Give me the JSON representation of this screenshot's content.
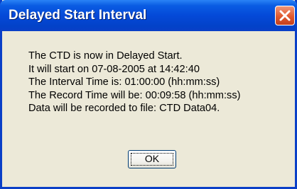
{
  "dialog": {
    "title": "Delayed Start Interval",
    "lines": [
      "The CTD is now in Delayed Start.",
      "It will start on 07-08-2005 at 14:42:40",
      "The Interval Time is: 01:00:00 (hh:mm:ss)",
      "The Record Time will be: 00:09:58 (hh:mm:ss)",
      "Data will be recorded to file: CTD Data04."
    ],
    "ok_label": "OK",
    "close_icon": "close-icon"
  },
  "colors": {
    "titlebar": "#0449d8",
    "frame": "#0a3fc7",
    "body": "#ece9d8",
    "close_button": "#e0592f"
  }
}
